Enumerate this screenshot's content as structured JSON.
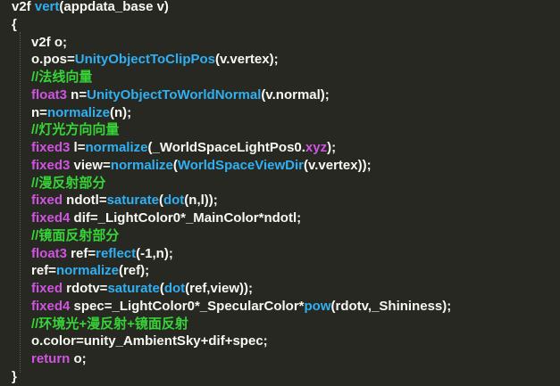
{
  "editor": {
    "lines": [
      {
        "indent": 0,
        "tokens": [
          {
            "text": "v2f ",
            "kind": "plain"
          },
          {
            "text": "vert",
            "kind": "func"
          },
          {
            "text": "(appdata_base v)",
            "kind": "plain"
          }
        ]
      },
      {
        "indent": 0,
        "tokens": [
          {
            "text": "{",
            "kind": "plain"
          }
        ]
      },
      {
        "indent": 1,
        "tokens": [
          {
            "text": "v2f o;",
            "kind": "plain"
          }
        ]
      },
      {
        "indent": 1,
        "tokens": [
          {
            "text": "o.pos=",
            "kind": "plain"
          },
          {
            "text": "UnityObjectToClipPos",
            "kind": "func"
          },
          {
            "text": "(v.vertex);",
            "kind": "plain"
          }
        ]
      },
      {
        "indent": 1,
        "tokens": [
          {
            "text": "//法线向量",
            "kind": "comment"
          }
        ]
      },
      {
        "indent": 1,
        "tokens": [
          {
            "text": "float3",
            "kind": "type"
          },
          {
            "text": " n=",
            "kind": "plain"
          },
          {
            "text": "UnityObjectToWorldNormal",
            "kind": "func"
          },
          {
            "text": "(v.normal);",
            "kind": "plain"
          }
        ]
      },
      {
        "indent": 1,
        "tokens": [
          {
            "text": "n=",
            "kind": "plain"
          },
          {
            "text": "normalize",
            "kind": "func"
          },
          {
            "text": "(n);",
            "kind": "plain"
          }
        ]
      },
      {
        "indent": 1,
        "tokens": [
          {
            "text": "//灯光方向向量",
            "kind": "comment"
          }
        ]
      },
      {
        "indent": 1,
        "tokens": [
          {
            "text": "fixed3",
            "kind": "type"
          },
          {
            "text": " l=",
            "kind": "plain"
          },
          {
            "text": "normalize",
            "kind": "func"
          },
          {
            "text": "(_WorldSpaceLightPos0.",
            "kind": "plain"
          },
          {
            "text": "xyz",
            "kind": "type"
          },
          {
            "text": ");",
            "kind": "plain"
          }
        ]
      },
      {
        "indent": 1,
        "tokens": [
          {
            "text": "fixed3",
            "kind": "type"
          },
          {
            "text": " view=",
            "kind": "plain"
          },
          {
            "text": "normalize",
            "kind": "func"
          },
          {
            "text": "(",
            "kind": "plain"
          },
          {
            "text": "WorldSpaceViewDir",
            "kind": "func"
          },
          {
            "text": "(v.vertex));",
            "kind": "plain"
          }
        ]
      },
      {
        "indent": 1,
        "tokens": [
          {
            "text": "//漫反射部分",
            "kind": "comment"
          }
        ]
      },
      {
        "indent": 1,
        "tokens": [
          {
            "text": "fixed",
            "kind": "type"
          },
          {
            "text": " ndotl=",
            "kind": "plain"
          },
          {
            "text": "saturate",
            "kind": "func"
          },
          {
            "text": "(",
            "kind": "plain"
          },
          {
            "text": "dot",
            "kind": "func"
          },
          {
            "text": "(n,l));",
            "kind": "plain"
          }
        ]
      },
      {
        "indent": 1,
        "tokens": [
          {
            "text": "fixed4",
            "kind": "type"
          },
          {
            "text": " dif=_LightColor0*_MainColor*ndotl;",
            "kind": "plain"
          }
        ]
      },
      {
        "indent": 1,
        "tokens": [
          {
            "text": "//镜面反射部分",
            "kind": "comment"
          }
        ]
      },
      {
        "indent": 1,
        "tokens": [
          {
            "text": "float3",
            "kind": "type"
          },
          {
            "text": " ref=",
            "kind": "plain"
          },
          {
            "text": "reflect",
            "kind": "func"
          },
          {
            "text": "(-1,n);",
            "kind": "plain"
          }
        ]
      },
      {
        "indent": 1,
        "tokens": [
          {
            "text": "ref=",
            "kind": "plain"
          },
          {
            "text": "normalize",
            "kind": "func"
          },
          {
            "text": "(ref);",
            "kind": "plain"
          }
        ]
      },
      {
        "indent": 1,
        "tokens": [
          {
            "text": "fixed",
            "kind": "type"
          },
          {
            "text": " rdotv=",
            "kind": "plain"
          },
          {
            "text": "saturate",
            "kind": "func"
          },
          {
            "text": "(",
            "kind": "plain"
          },
          {
            "text": "dot",
            "kind": "func"
          },
          {
            "text": "(ref,view));",
            "kind": "plain"
          }
        ]
      },
      {
        "indent": 1,
        "tokens": [
          {
            "text": "fixed4",
            "kind": "type"
          },
          {
            "text": " spec=_LightColor0*_SpecularColor*",
            "kind": "plain"
          },
          {
            "text": "pow",
            "kind": "func"
          },
          {
            "text": "(rdotv,_Shininess);",
            "kind": "plain"
          }
        ]
      },
      {
        "indent": 1,
        "tokens": [
          {
            "text": "//环境光+漫反射+镜面反射",
            "kind": "comment"
          }
        ]
      },
      {
        "indent": 1,
        "tokens": [
          {
            "text": "o.color=unity_AmbientSky+dif+spec;",
            "kind": "plain"
          }
        ]
      },
      {
        "indent": 1,
        "tokens": [
          {
            "text": "return",
            "kind": "type"
          },
          {
            "text": " o;",
            "kind": "plain"
          }
        ]
      },
      {
        "indent": 0,
        "tokens": [
          {
            "text": "}",
            "kind": "plain"
          }
        ]
      }
    ]
  },
  "theme": {
    "background": "#272822",
    "plain": "#f8f8f2",
    "type": "#cf54e0",
    "func": "#30b0f2",
    "comment": "#37d438"
  }
}
